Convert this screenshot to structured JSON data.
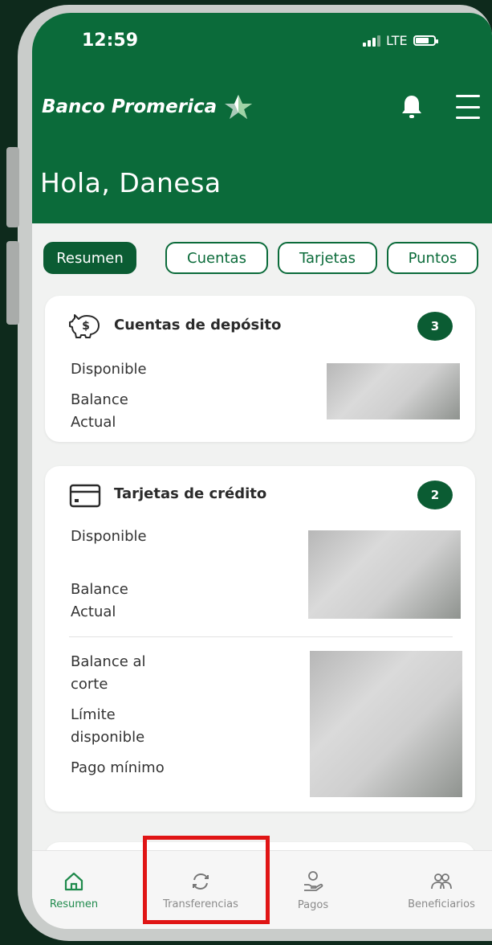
{
  "status_bar": {
    "time": "12:59",
    "network": "LTE"
  },
  "header": {
    "brand": "Banco Promerica",
    "greeting": "Hola, Danesa"
  },
  "tabs": [
    {
      "label": "Resumen",
      "active": true
    },
    {
      "label": "Cuentas",
      "active": false
    },
    {
      "label": "Tarjetas",
      "active": false
    },
    {
      "label": "Puntos",
      "active": false
    }
  ],
  "deposit_card": {
    "title": "Cuentas de depósito",
    "count": "3",
    "rows": [
      "Disponible",
      "Balance Actual"
    ]
  },
  "credit_card": {
    "title": "Tarjetas de crédito",
    "count": "2",
    "rows": [
      "Disponible",
      "Balance Actual"
    ],
    "rows2": [
      "Balance al corte",
      "Límite disponible",
      "Pago mínimo"
    ]
  },
  "bottom_nav": [
    {
      "label": "Resumen",
      "icon": "home-icon",
      "active": true
    },
    {
      "label": "Transferencias",
      "icon": "refresh-icon",
      "active": false
    },
    {
      "label": "Pagos",
      "icon": "hand-coin-icon",
      "active": false
    },
    {
      "label": "Beneficiarios",
      "icon": "users-icon",
      "active": false
    }
  ],
  "colors": {
    "brand_green": "#0b6b3a",
    "badge_green": "#0b5c33",
    "highlight": "#e01515"
  }
}
